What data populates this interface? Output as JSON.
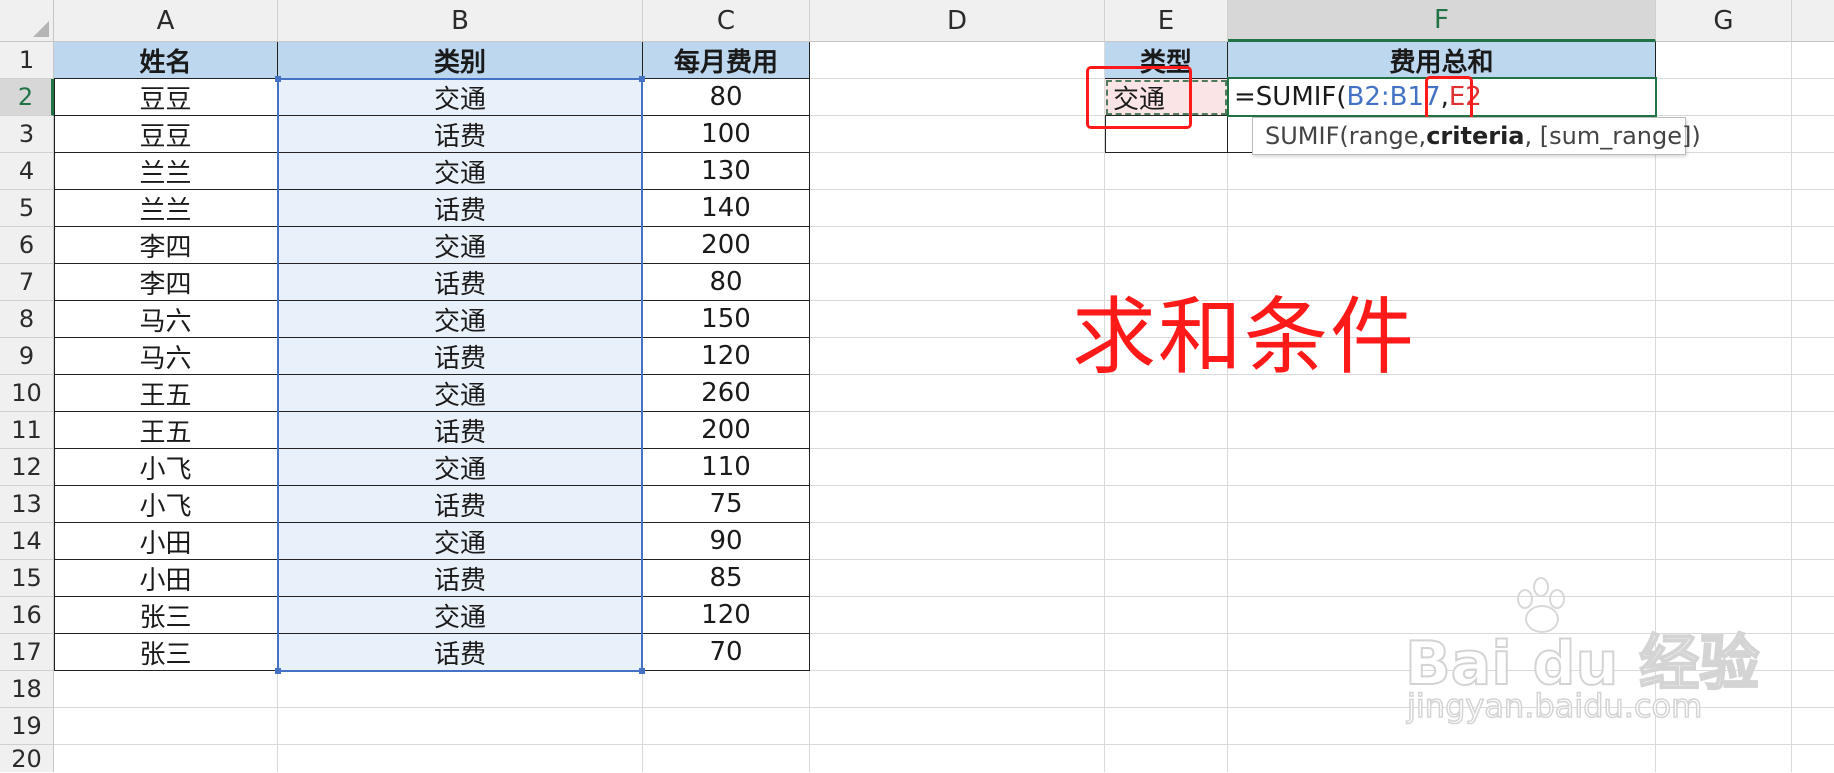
{
  "columns": [
    "A",
    "B",
    "C",
    "D",
    "E",
    "F",
    "G"
  ],
  "rows": [
    "1",
    "2",
    "3",
    "4",
    "5",
    "6",
    "7",
    "8",
    "9",
    "10",
    "11",
    "12",
    "13",
    "14",
    "15",
    "16",
    "17",
    "18",
    "19",
    "20"
  ],
  "table": {
    "headers": [
      "姓名",
      "类别",
      "每月费用"
    ],
    "data": [
      [
        "豆豆",
        "交通",
        "80"
      ],
      [
        "豆豆",
        "话费",
        "100"
      ],
      [
        "兰兰",
        "交通",
        "130"
      ],
      [
        "兰兰",
        "话费",
        "140"
      ],
      [
        "李四",
        "交通",
        "200"
      ],
      [
        "李四",
        "话费",
        "80"
      ],
      [
        "马六",
        "交通",
        "150"
      ],
      [
        "马六",
        "话费",
        "120"
      ],
      [
        "王五",
        "交通",
        "260"
      ],
      [
        "王五",
        "话费",
        "200"
      ],
      [
        "小飞",
        "交通",
        "110"
      ],
      [
        "小飞",
        "话费",
        "75"
      ],
      [
        "小田",
        "交通",
        "90"
      ],
      [
        "小田",
        "话费",
        "85"
      ],
      [
        "张三",
        "交通",
        "120"
      ],
      [
        "张三",
        "话费",
        "70"
      ]
    ]
  },
  "summary": {
    "header_type": "类型",
    "header_sum": "费用总和",
    "criteria_value": "交通"
  },
  "formula": {
    "prefix": "=SUMIF(",
    "range_ref": "B2:B17",
    "separator": ",",
    "criteria_ref": "E2"
  },
  "tooltip": {
    "func": "SUMIF(",
    "arg1": "range, ",
    "arg2": "criteria",
    "arg3": ", [sum_range])"
  },
  "annotation": "求和条件",
  "watermark": {
    "logo_text": "Bai du 经验",
    "url": "jingyan.baidu.com"
  },
  "colors": {
    "range_ref": "#4472c4",
    "criteria_ref": "#e03131",
    "annotation": "#ff1a1a",
    "header_fill": "#bdd7ee",
    "excel_green": "#217346"
  }
}
